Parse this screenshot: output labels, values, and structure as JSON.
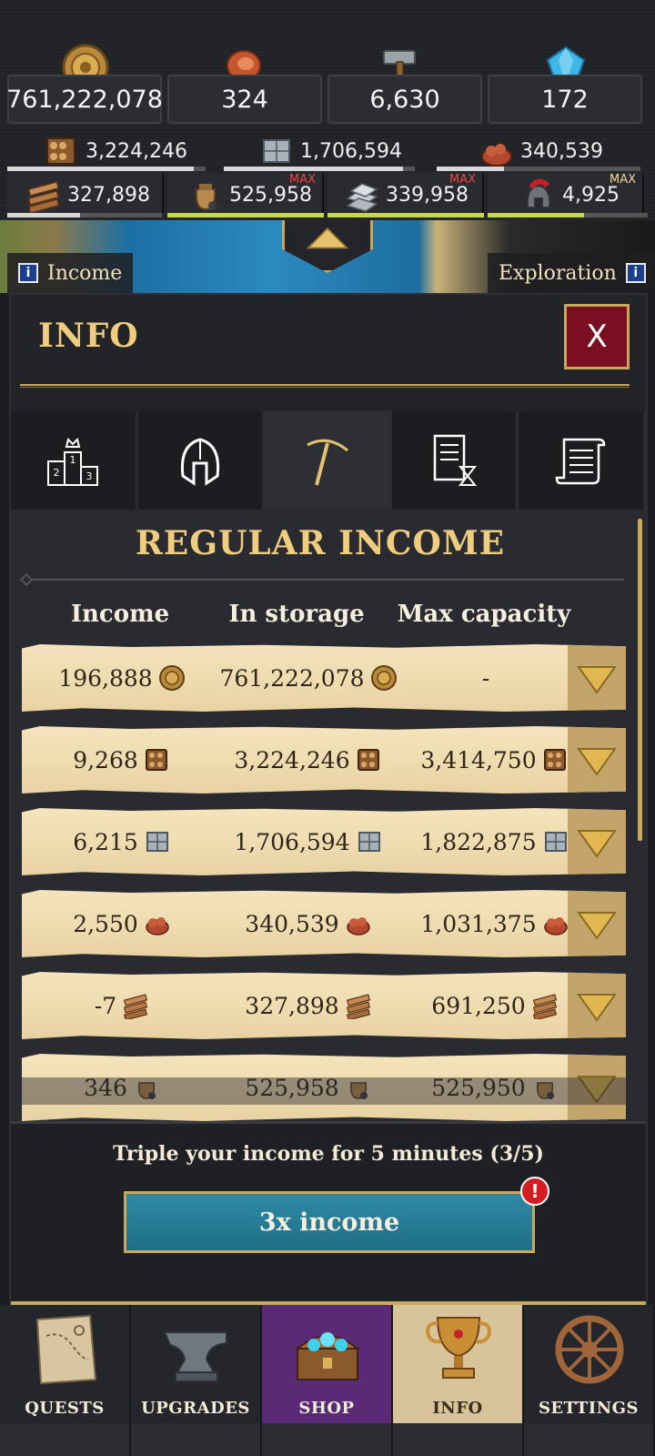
{
  "top_resources": {
    "main": [
      {
        "name": "gold",
        "icon": "gold-coin-icon",
        "value": "761,222,078"
      },
      {
        "name": "food",
        "icon": "meat-icon",
        "value": "324"
      },
      {
        "name": "tools",
        "icon": "hammer-icon",
        "value": "6,630"
      },
      {
        "name": "gems",
        "icon": "diamond-icon",
        "value": "172"
      }
    ],
    "secondary": [
      {
        "name": "wood",
        "icon": "wood-logs-icon",
        "value": "3,224,246",
        "fill": 0.94
      },
      {
        "name": "stone",
        "icon": "stone-block-icon",
        "value": "1,706,594",
        "fill": 0.94
      },
      {
        "name": "ore",
        "icon": "ore-pile-icon",
        "value": "340,539",
        "fill": 0.33
      }
    ],
    "tertiary": [
      {
        "name": "planks",
        "icon": "planks-icon",
        "value": "327,898",
        "max": "",
        "fill": 0.47
      },
      {
        "name": "coal",
        "icon": "coal-sack-icon",
        "value": "525,958",
        "max": "MAX",
        "fill": 1.0
      },
      {
        "name": "silver",
        "icon": "silver-ingots-icon",
        "value": "339,958",
        "max": "MAX",
        "fill": 1.0
      },
      {
        "name": "soldiers",
        "icon": "spartan-helmet-icon",
        "value": "4,925",
        "max": "MAX",
        "fill": 0.6
      }
    ]
  },
  "map": {
    "left_tab": "Income",
    "right_tab": "Exploration"
  },
  "panel": {
    "title": "INFO",
    "close_label": "X",
    "tabs": [
      {
        "name": "ranking",
        "icon": "podium-icon"
      },
      {
        "name": "army",
        "icon": "helmet-icon"
      },
      {
        "name": "income",
        "icon": "pickaxe-icon",
        "active": true
      },
      {
        "name": "reports",
        "icon": "document-hourglass-icon"
      },
      {
        "name": "log",
        "icon": "scroll-icon"
      }
    ],
    "section_title": "REGULAR INCOME",
    "columns": [
      "Income",
      "In storage",
      "Max capacity"
    ],
    "rows": [
      {
        "income": "196,888",
        "storage": "761,222,078",
        "capacity": "-",
        "icon": "gold-coin-icon"
      },
      {
        "income": "9,268",
        "storage": "3,224,246",
        "capacity": "3,414,750",
        "icon": "wood-logs-icon"
      },
      {
        "income": "6,215",
        "storage": "1,706,594",
        "capacity": "1,822,875",
        "icon": "stone-block-icon"
      },
      {
        "income": "2,550",
        "storage": "340,539",
        "capacity": "1,031,375",
        "icon": "ore-pile-icon"
      },
      {
        "income": "-7",
        "storage": "327,898",
        "capacity": "691,250",
        "icon": "planks-icon"
      },
      {
        "income": "346",
        "storage": "525,958",
        "capacity": "525,950",
        "icon": "coal-sack-icon"
      }
    ],
    "promo_text": "Triple your income for 5 minutes (3/5)",
    "promo_button": "3x income",
    "alert": "!"
  },
  "bottom_nav": [
    {
      "label": "QUESTS",
      "icon": "map-icon"
    },
    {
      "label": "UPGRADES",
      "icon": "anvil-icon"
    },
    {
      "label": "SHOP",
      "icon": "treasure-chest-icon"
    },
    {
      "label": "INFO",
      "icon": "trophy-icon",
      "active": true
    },
    {
      "label": "SETTINGS",
      "icon": "wheel-icon"
    }
  ],
  "colors": {
    "gold_accent": "#c9a85c",
    "title_gold": "#f0cc7e",
    "close_red": "#7b0f22",
    "button_teal": "#2f8aa5",
    "shop_purple": "#5b2a76",
    "row_parchment": "#f4e3bc"
  }
}
